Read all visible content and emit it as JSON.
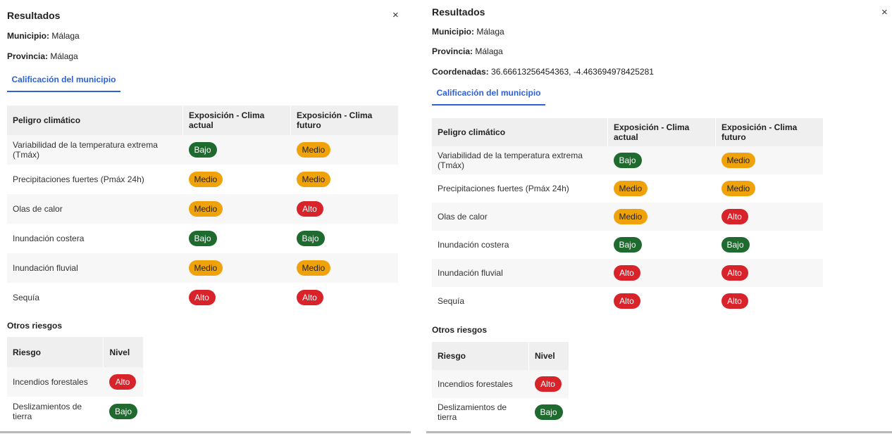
{
  "colors": {
    "bajo": "#1f6a2e",
    "medio": "#f0a20a",
    "alto": "#d8232a",
    "tab_accent": "#2c62d6"
  },
  "left": {
    "title": "Resultados",
    "close": "×",
    "municipio_label": "Municipio:",
    "municipio_value": "Málaga",
    "provincia_label": "Provincia:",
    "provincia_value": "Málaga",
    "tab": "Calificación del municipio",
    "table": {
      "headers": [
        "Peligro climático",
        "Exposición - Clima actual",
        "Exposición - Clima futuro"
      ],
      "rows": [
        {
          "peligro": "Variabilidad de la temperatura extrema (Tmáx)",
          "actual": "Bajo",
          "futuro": "Medio"
        },
        {
          "peligro": "Precipitaciones fuertes (Pmáx 24h)",
          "actual": "Medio",
          "futuro": "Medio"
        },
        {
          "peligro": "Olas de calor",
          "actual": "Medio",
          "futuro": "Alto"
        },
        {
          "peligro": "Inundación costera",
          "actual": "Bajo",
          "futuro": "Bajo"
        },
        {
          "peligro": "Inundación fluvial",
          "actual": "Medio",
          "futuro": "Medio"
        },
        {
          "peligro": "Sequía",
          "actual": "Alto",
          "futuro": "Alto"
        }
      ]
    },
    "otros_title": "Otros riesgos",
    "otros": {
      "headers": [
        "Riesgo",
        "Nivel"
      ],
      "rows": [
        {
          "riesgo": "Incendios forestales",
          "nivel": "Alto"
        },
        {
          "riesgo": "Deslizamientos de tierra",
          "nivel": "Bajo"
        }
      ]
    }
  },
  "right": {
    "title": "Resultados",
    "close": "×",
    "municipio_label": "Municipio:",
    "municipio_value": "Málaga",
    "provincia_label": "Provincia:",
    "provincia_value": "Málaga",
    "coordenadas_label": "Coordenadas:",
    "coordenadas_value": "36.66613256454363, -4.463694978425281",
    "tab": "Calificación del municipio",
    "table": {
      "headers": [
        "Peligro climático",
        "Exposición - Clima actual",
        "Exposición - Clima futuro"
      ],
      "rows": [
        {
          "peligro": "Variabilidad de la temperatura extrema (Tmáx)",
          "actual": "Bajo",
          "futuro": "Medio"
        },
        {
          "peligro": "Precipitaciones fuertes (Pmáx 24h)",
          "actual": "Medio",
          "futuro": "Medio"
        },
        {
          "peligro": "Olas de calor",
          "actual": "Medio",
          "futuro": "Alto"
        },
        {
          "peligro": "Inundación costera",
          "actual": "Bajo",
          "futuro": "Bajo"
        },
        {
          "peligro": "Inundación fluvial",
          "actual": "Alto",
          "futuro": "Alto"
        },
        {
          "peligro": "Sequía",
          "actual": "Alto",
          "futuro": "Alto"
        }
      ]
    },
    "otros_title": "Otros riesgos",
    "otros": {
      "headers": [
        "Riesgo",
        "Nivel"
      ],
      "rows": [
        {
          "riesgo": "Incendios forestales",
          "nivel": "Alto"
        },
        {
          "riesgo": "Deslizamientos de tierra",
          "nivel": "Bajo"
        }
      ]
    }
  }
}
